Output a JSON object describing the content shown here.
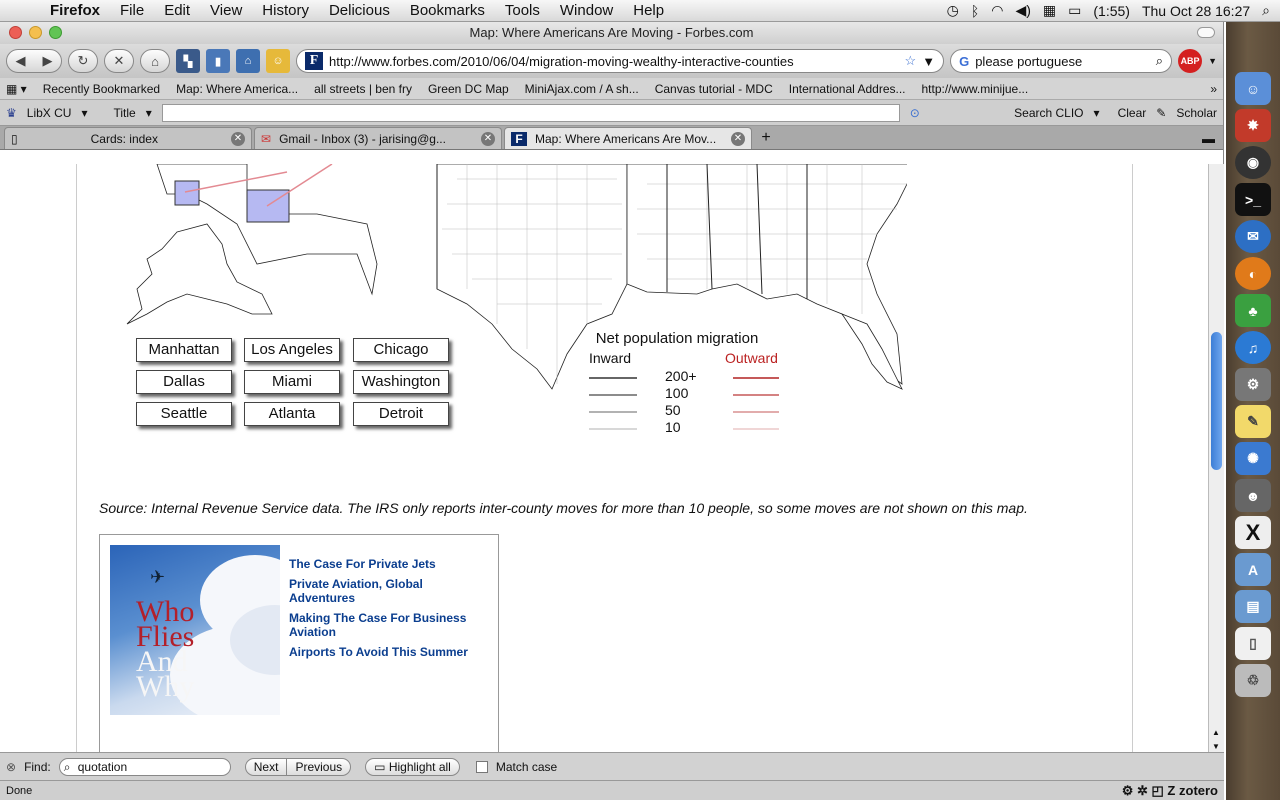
{
  "menubar": {
    "app_name": "Firefox",
    "menus": [
      "File",
      "Edit",
      "View",
      "History",
      "Delicious",
      "Bookmarks",
      "Tools",
      "Window",
      "Help"
    ],
    "battery": "(1:55)",
    "clock": "Thu Oct 28  16:27"
  },
  "window": {
    "title": "Map: Where Americans Are Moving - Forbes.com"
  },
  "navbar": {
    "url": "http://www.forbes.com/2010/06/04/migration-moving-wealthy-interactive-counties",
    "search_value": "please portuguese",
    "search_engine": "G",
    "favicon": "F",
    "abp": "ABP"
  },
  "bookmarks": [
    "Recently Bookmarked",
    "Map: Where America...",
    "all streets | ben fry",
    "Green DC Map",
    "MiniAjax.com / A sh...",
    "Canvas tutorial - MDC",
    "International Addres...",
    "http://www.minijue..."
  ],
  "toolbar3": {
    "libx": "LibX CU",
    "title_label": "Title",
    "search_clio": "Search CLIO",
    "clear": "Clear",
    "scholar": "Scholar"
  },
  "tabs": [
    {
      "label": "Cards: index"
    },
    {
      "label": "Gmail - Inbox (3) - jarising@g..."
    },
    {
      "label": "Map: Where Americans Are Mov..."
    }
  ],
  "map": {
    "cities": [
      "Manhattan",
      "Los Angeles",
      "Chicago",
      "Dallas",
      "Miami",
      "Washington",
      "Seattle",
      "Atlanta",
      "Detroit"
    ],
    "legend": {
      "title": "Net population migration",
      "inward": "Inward",
      "outward": "Outward",
      "levels": [
        "200+",
        "100",
        "50",
        "10"
      ],
      "inward_color": "#333333",
      "outward_color": "#b22222"
    }
  },
  "source_note": "Source: Internal Revenue Service data. The IRS only reports inter-county moves for more than 10 people, so some moves are not shown on this map.",
  "promo": {
    "image_text": [
      "Who",
      "Flies",
      "And",
      "Why"
    ],
    "links": [
      "The Case For Private Jets",
      "Private Aviation, Global Adventures",
      "Making The Case For Business Aviation",
      "Airports To Avoid This Summer"
    ]
  },
  "findbar": {
    "label": "Find:",
    "query": "quotation",
    "next": "Next",
    "previous": "Previous",
    "highlight": "Highlight all",
    "match_case": "Match case"
  },
  "statusbar": {
    "status": "Done",
    "zotero": "zotero"
  }
}
